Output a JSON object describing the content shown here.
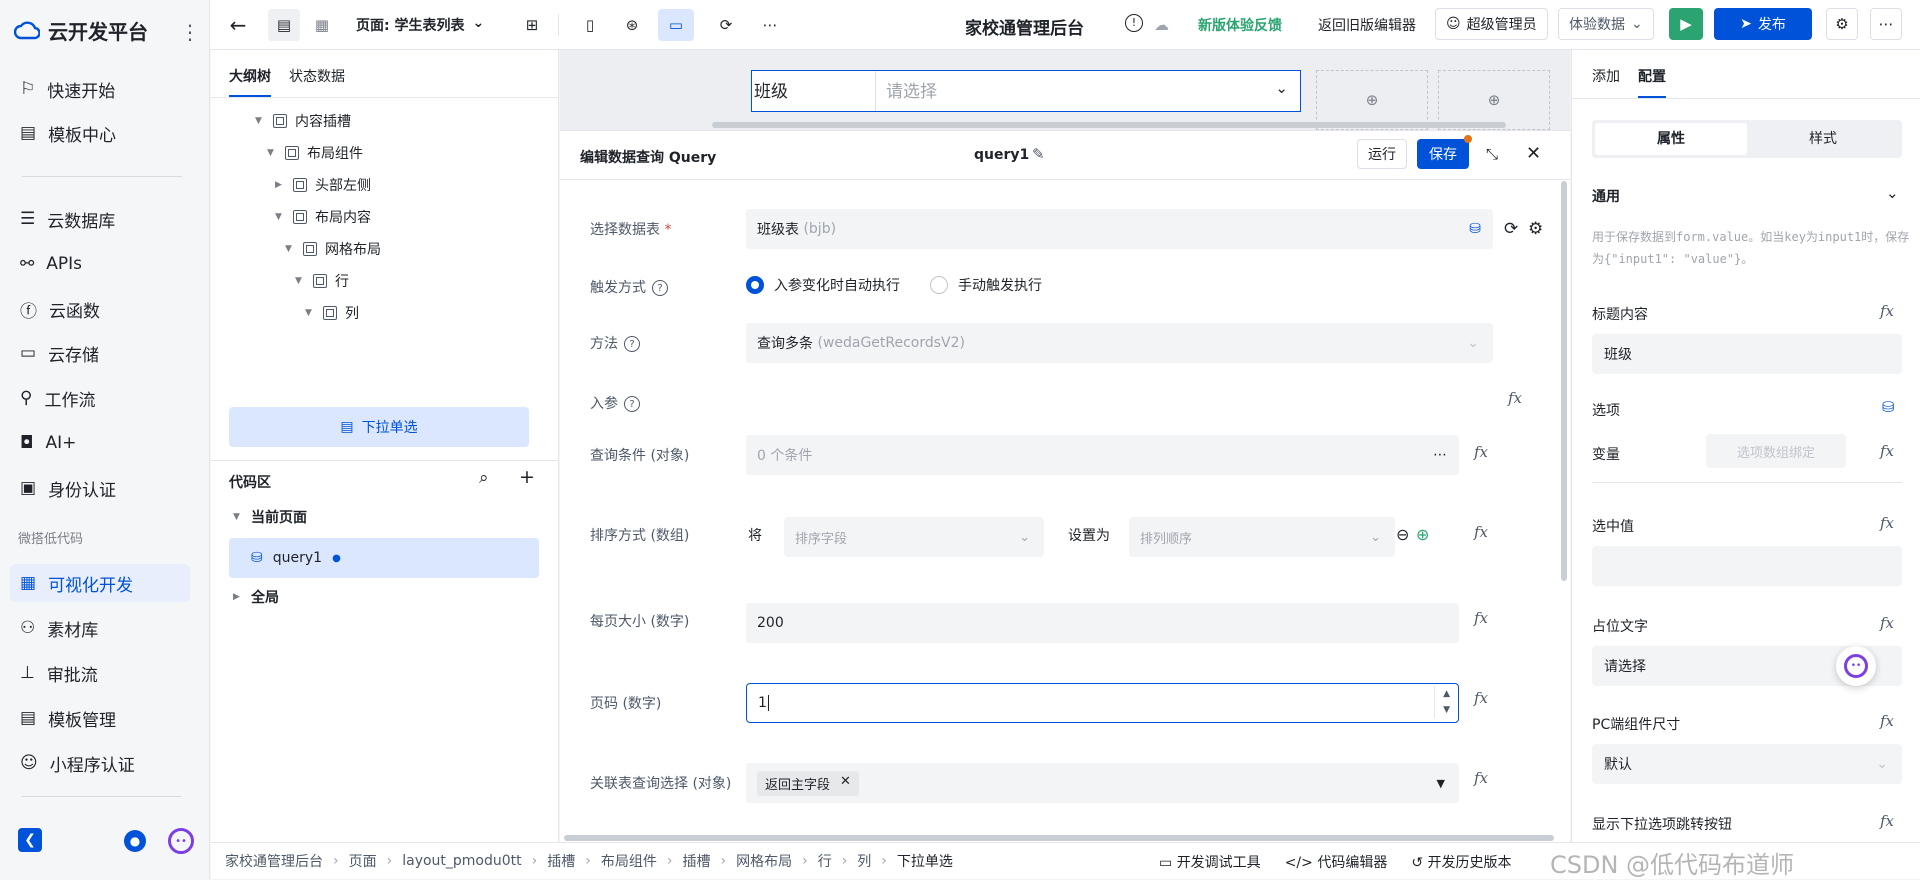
{
  "brand": {
    "name": "云开发平台"
  },
  "nav": {
    "items": [
      "快速开始",
      "模板中心",
      "云数据库",
      "APIs",
      "云函数",
      "云存储",
      "工作流",
      "AI+",
      "身份认证"
    ],
    "section": "微搭低代码",
    "items2": [
      "可视化开发",
      "素材库",
      "审批流",
      "模板管理",
      "小程序认证"
    ]
  },
  "topbar": {
    "page_label": "页面: 学生表列表",
    "app_title": "家校通管理后台",
    "feedback": "新版体验反馈",
    "old_editor": "返回旧版编辑器",
    "admin": "超级管理员",
    "env": "体验数据",
    "publish": "发布"
  },
  "outline": {
    "tabs": [
      "大纲树",
      "状态数据"
    ],
    "tree": [
      "内容插槽",
      "布局组件",
      "头部左侧",
      "布局内容",
      "网格布局",
      "行",
      "列",
      "下拉单选"
    ],
    "code_title": "代码区",
    "current_page": "当前页面",
    "query": "query1",
    "global": "全局"
  },
  "canvas": {
    "field_label": "班级",
    "placeholder": "请选择"
  },
  "query_editor": {
    "title": "编辑数据查询 Query",
    "name": "query1",
    "run": "运行",
    "save": "保存",
    "rows": {
      "table_label": "选择数据表",
      "table_value": "班级表",
      "table_code": "(bjb)",
      "trigger_label": "触发方式",
      "trigger_auto": "入参变化时自动执行",
      "trigger_manual": "手动触发执行",
      "method_label": "方法",
      "method_value": "查询多条",
      "method_code": "(wedaGetRecordsV2)",
      "params_label": "入参",
      "cond_label": "查询条件 (对象)",
      "cond_value": "0 个条件",
      "sort_label": "排序方式 (数组)",
      "sort_prefix": "将",
      "sort_field": "排序字段",
      "sort_set": "设置为",
      "sort_order": "排列顺序",
      "page_size_label": "每页大小 (数字)",
      "page_size": "200",
      "page_no_label": "页码 (数字)",
      "page_no": "1",
      "relation_label": "关联表查询选择 (对象)",
      "relation_tag": "返回主字段"
    }
  },
  "right_panel": {
    "tabs": [
      "添加",
      "配置"
    ],
    "seg": [
      "属性",
      "样式"
    ],
    "general": "通用",
    "hint": "用于保存数据到form.value。如当key为input1时，保存为{\"input1\": \"value\"}。",
    "title_label": "标题内容",
    "title_value": "班级",
    "options_label": "选项",
    "var_label": "变量",
    "var_placeholder": "选项数组绑定",
    "selected_label": "选中值",
    "placeholder_label": "占位文字",
    "placeholder_value": "请选择",
    "size_label": "PC端组件尺寸",
    "size_value": "默认",
    "jump_label": "显示下拉选项跳转按钮"
  },
  "status": {
    "crumbs": [
      "家校通管理后台",
      "页面",
      "layout_pmodu0tt",
      "插槽",
      "布局组件",
      "插槽",
      "网格布局",
      "行",
      "列",
      "下拉单选"
    ],
    "debug": "开发调试工具",
    "code_editor": "代码编辑器",
    "history": "开发历史版本",
    "watermark": "CSDN @低代码布道师"
  },
  "colors": {
    "primary": "#0052d9",
    "run_green": "#2ba471",
    "feedback_green": "#2ba471"
  }
}
